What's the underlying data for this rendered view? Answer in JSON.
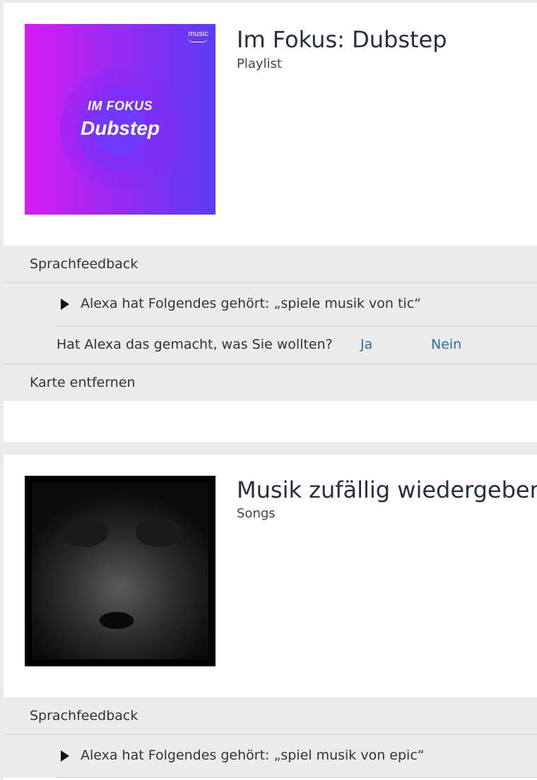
{
  "cards": [
    {
      "title": "Im Fokus: Dubstep",
      "subtitle": "Playlist",
      "art": {
        "brand": "music",
        "line1": "IM FOKUS",
        "line2": "Dubstep",
        "colors": {
          "left": "#d61cf2",
          "right": "#5a3cf4"
        }
      },
      "feedback": {
        "header": "Sprachfeedback",
        "heard": "Alexa hat Folgendes gehört: „spiele musik von tic“",
        "question": "Hat Alexa das gemacht, was Sie wollten?",
        "yes": "Ja",
        "no": "Nein",
        "remove": "Karte entfernen"
      }
    },
    {
      "title": "Musik zufällig wiedergeben",
      "subtitle": "Songs",
      "art": {
        "description_icon": "album-photo"
      },
      "feedback": {
        "header": "Sprachfeedback",
        "heard": "Alexa hat Folgendes gehört: „spiel musik von epic“"
      }
    }
  ],
  "colors": {
    "link": "#2a6fa6",
    "title": "#232f3e",
    "panel": "#ebebeb"
  }
}
